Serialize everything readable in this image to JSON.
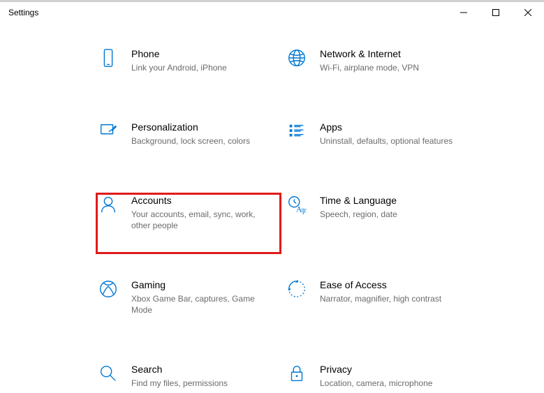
{
  "window": {
    "title": "Settings"
  },
  "tiles": [
    {
      "title": "Phone",
      "desc": "Link your Android, iPhone"
    },
    {
      "title": "Network & Internet",
      "desc": "Wi-Fi, airplane mode, VPN"
    },
    {
      "title": "Personalization",
      "desc": "Background, lock screen, colors"
    },
    {
      "title": "Apps",
      "desc": "Uninstall, defaults, optional features"
    },
    {
      "title": "Accounts",
      "desc": "Your accounts, email, sync, work, other people"
    },
    {
      "title": "Time & Language",
      "desc": "Speech, region, date"
    },
    {
      "title": "Gaming",
      "desc": "Xbox Game Bar, captures, Game Mode"
    },
    {
      "title": "Ease of Access",
      "desc": "Narrator, magnifier, high contrast"
    },
    {
      "title": "Search",
      "desc": "Find my files, permissions"
    },
    {
      "title": "Privacy",
      "desc": "Location, camera, microphone"
    }
  ]
}
